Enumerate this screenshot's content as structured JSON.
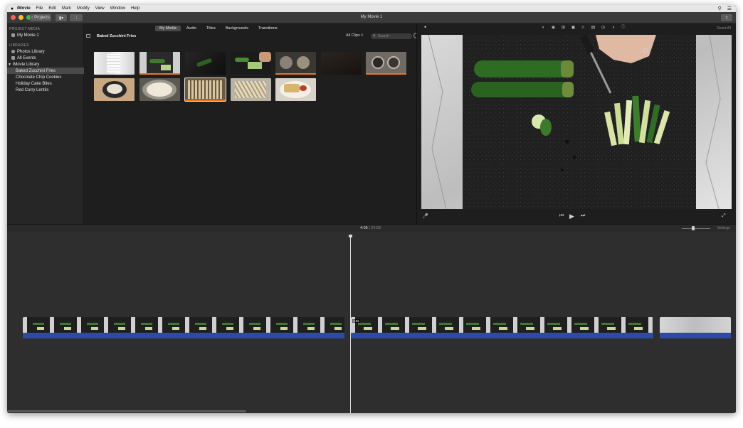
{
  "menubar": {
    "apple": "",
    "items": [
      "iMovie",
      "File",
      "Edit",
      "Mark",
      "Modify",
      "View",
      "Window",
      "Help"
    ],
    "right_icons": [
      "search-icon",
      "list-icon"
    ]
  },
  "window": {
    "title": "My Movie 1",
    "projects_button": "Projects"
  },
  "sidebar": {
    "project_media_heading": "PROJECT MEDIA",
    "project_item": "My Movie 1",
    "libraries_heading": "LIBRARIES",
    "photos_library": "Photos Library",
    "all_events": "All Events",
    "library_name": "iMovie Library",
    "events": [
      "Baked Zucchini Fries",
      "Chocolate Chip Cookies",
      "Holiday Cake Bites",
      "Red Curry Lentils"
    ],
    "selected_event": "Baked Zucchini Fries"
  },
  "browser": {
    "tabs": [
      "My Media",
      "Audio",
      "Titles",
      "Backgrounds",
      "Transitions"
    ],
    "active_tab": "My Media",
    "event_title": "Baked Zucchini Fries",
    "filter": "All Clips ◊",
    "search_placeholder": "Search"
  },
  "viewer": {
    "reset_label": "Reset All",
    "tools": [
      "magic-wand-icon",
      "color-balance-icon",
      "color-correction-icon",
      "crop-icon",
      "stabilize-icon",
      "volume-icon",
      "equalizer-icon",
      "speed-icon",
      "filter-icon",
      "info-icon"
    ]
  },
  "timeline": {
    "current_time": "4:05",
    "separator": " | ",
    "total_time": "24:58",
    "settings_label": "Settings",
    "clip_badge": "3.0s"
  },
  "colors": {
    "accent_orange": "#e8791f",
    "audio_blue": "#2c4aa8",
    "selection_gray": "#4a4a4a"
  }
}
